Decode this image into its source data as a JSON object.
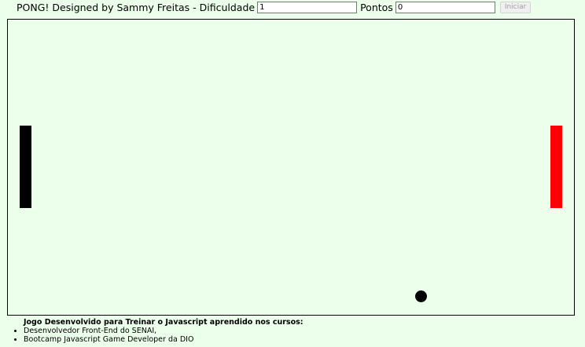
{
  "header": {
    "title": "PONG! Designed by Sammy Freitas - Dificuldade",
    "difficulty_value": "1",
    "points_label": "Pontos",
    "points_value": "0",
    "start_button_label": "Iniciar"
  },
  "game": {
    "left_paddle_color": "#000000",
    "right_paddle_color": "#ff0000",
    "ball_color": "#000000",
    "background_color": "#ebffeb"
  },
  "footer": {
    "title": "Jogo Desenvolvido para Treinar o Javascript aprendido nos cursos:",
    "courses": [
      "Desenvolvedor Front-End do SENAI,",
      "Bootcamp Javascript Game Developer da DIO"
    ]
  }
}
